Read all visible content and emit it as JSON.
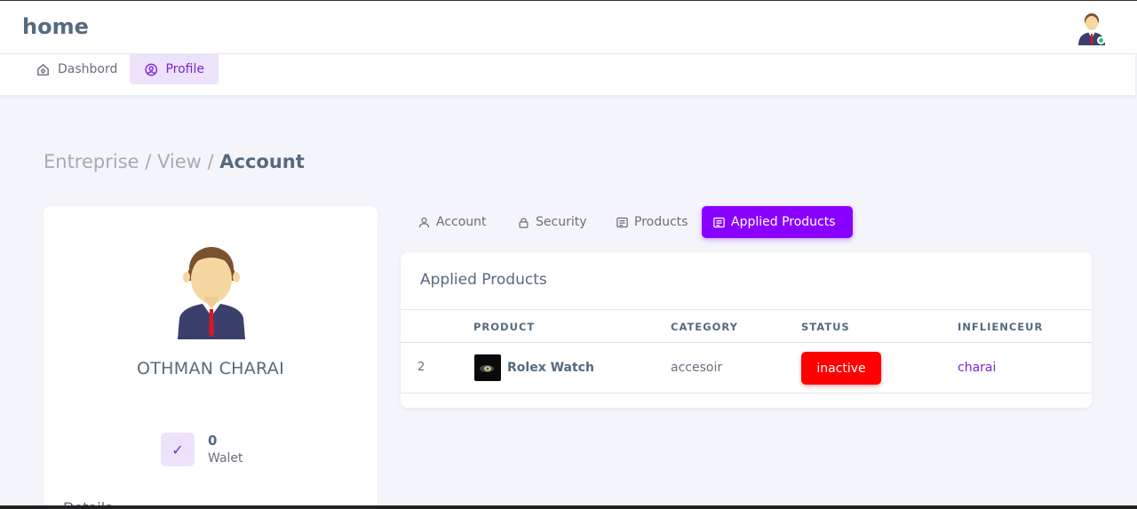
{
  "topbar": {
    "brand": "home",
    "avatar_icon": "user-avatar-icon",
    "status_color": "#28c76f"
  },
  "nav": {
    "items": [
      {
        "label": "Dashbord",
        "icon": "home-icon",
        "active": false
      },
      {
        "label": "Profile",
        "icon": "user-circle-icon",
        "active": true
      }
    ]
  },
  "breadcrumb": {
    "part1": "Entreprise / ",
    "part2": "View / ",
    "current": "Account"
  },
  "profile": {
    "name": "OTHMAN CHARAI",
    "wallet_value": "0",
    "wallet_label": "Walet",
    "details_heading": "Details"
  },
  "tabs": [
    {
      "label": "Account",
      "icon": "user-icon"
    },
    {
      "label": "Security",
      "icon": "lock-icon"
    },
    {
      "label": "Products",
      "icon": "list-icon"
    },
    {
      "label": "Applied Products",
      "icon": "list-icon",
      "active": true
    }
  ],
  "applied": {
    "title": "Applied Products",
    "columns": [
      "PRODUCT",
      "CATEGORY",
      "STATUS",
      "INFLIENCEUR"
    ],
    "rows": [
      {
        "index": "2",
        "product": "Rolex Watch",
        "category": "accesoir",
        "status": "inactive",
        "influencer": "charai"
      }
    ]
  },
  "colors": {
    "accent": "#8a00ff",
    "accent_soft": "#ece3fb",
    "danger": "#ff0000",
    "link": "#7e22ce"
  }
}
